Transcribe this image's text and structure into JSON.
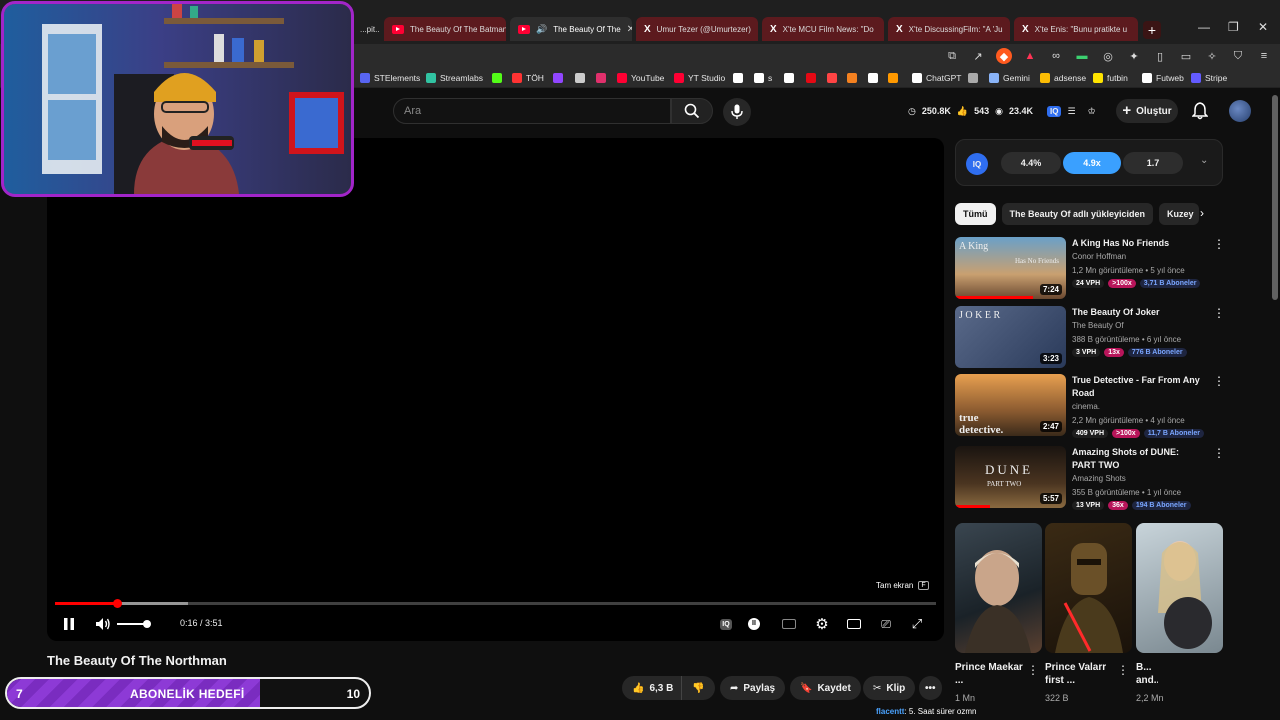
{
  "tabs": [
    {
      "title": "...pit...",
      "type": "yt"
    },
    {
      "title": "The Beauty Of The Batman",
      "type": "yt"
    },
    {
      "title": "The Beauty Of The",
      "type": "yt",
      "active": true
    },
    {
      "title": "Umur Tezer (@Umurtezer)",
      "type": "x"
    },
    {
      "title": "X'te MCU Film News: \"Do",
      "type": "x"
    },
    {
      "title": "X'te DiscussingFilm: \"A 'Ju",
      "type": "x"
    },
    {
      "title": "X'te Enis: \"Bunu pratikte u",
      "type": "x"
    }
  ],
  "window_controls": {
    "minimize": "—",
    "maximize": "❐",
    "close": "✕"
  },
  "bookmarks": [
    {
      "label": "STElements",
      "color": "#5865f2"
    },
    {
      "label": "Streamlabs",
      "color": "#31c3a2"
    },
    {
      "label": "",
      "color": "#53fc18"
    },
    {
      "label": "TÖH",
      "color": "#ff3333"
    },
    {
      "label": "",
      "color": "#9146ff"
    },
    {
      "label": "",
      "color": "#cccccc"
    },
    {
      "label": "",
      "color": "#e1306c"
    },
    {
      "label": "YouTube",
      "color": "#ff0033"
    },
    {
      "label": "YT Studio",
      "color": "#ff0033"
    },
    {
      "label": "",
      "color": "#ffffff"
    },
    {
      "label": "s",
      "color": "#ffffff"
    },
    {
      "label": "",
      "color": "#ffffff"
    },
    {
      "label": "",
      "color": "#e50914"
    },
    {
      "label": "",
      "color": "#ff4444"
    },
    {
      "label": "",
      "color": "#f48120"
    },
    {
      "label": "",
      "color": "#ffffff"
    },
    {
      "label": "",
      "color": "#ff9900"
    },
    {
      "label": "ChatGPT",
      "color": "#ffffff"
    },
    {
      "label": "",
      "color": "#aaaaaa"
    },
    {
      "label": "Gemini",
      "color": "#8ab4f8"
    },
    {
      "label": "adsense",
      "color": "#fbbc04"
    },
    {
      "label": "futbin",
      "color": "#ffe400"
    },
    {
      "label": "Futweb",
      "color": "#ffffff"
    },
    {
      "label": "Stripe",
      "color": "#635bff"
    }
  ],
  "header": {
    "search_placeholder": "Ara",
    "stats": {
      "views": "250.8K",
      "likes": "543",
      "eye": "23.4K"
    },
    "create_label": "Oluştur"
  },
  "player": {
    "current_time": "0:16",
    "separator": " / ",
    "duration": "3:51",
    "played_fraction": 0.07,
    "buffered_fraction": 0.151,
    "fullscreen_tip": "Tam ekran",
    "fullscreen_key": "F"
  },
  "video_title": "The Beauty Of The Northman",
  "actions": {
    "like_count": "6,3 B",
    "share": "Paylaş",
    "save": "Kaydet",
    "clip": "Klip"
  },
  "chat": {
    "user": "flacentt",
    "message": ": 5. Saat sürer ozmn"
  },
  "goal": {
    "left": "7",
    "label": "ABONELİK HEDEFİ",
    "right": "10",
    "fill_fraction": 0.7
  },
  "vidiq": {
    "logo": "IQ",
    "seg1": "4.4%",
    "seg2": "4.9x",
    "seg3": "1.7"
  },
  "chips": [
    "Tümü",
    "The Beauty Of adlı yükleyiciden",
    "Kuzey"
  ],
  "recommendations": [
    {
      "title": "A King Has No Friends",
      "channel": "Conor Hoffman",
      "meta": "1,2 Mn görüntüleme • 5 yıl önce",
      "duration": "7:24",
      "vph": "24 VPH",
      "ratio": ">100x",
      "subs": "3,71 B Aboneler",
      "thumb_text": "A King",
      "thumb_text2": "Has No Friends"
    },
    {
      "title": "The Beauty Of Joker",
      "channel": "The Beauty Of",
      "meta": "388 B görüntüleme • 6 yıl önce",
      "duration": "3:23",
      "vph": "3 VPH",
      "ratio": "13x",
      "subs": "776 B Aboneler",
      "thumb_text": "J  O  K  E  R",
      "thumb_text2": ""
    },
    {
      "title": "True Detective - Far From Any Road",
      "channel": "cinema.",
      "meta": "2,2 Mn görüntüleme • 4 yıl önce",
      "duration": "2:47",
      "vph": "409 VPH",
      "ratio": ">100x",
      "subs": "11,7 B Aboneler",
      "thumb_text": "true",
      "thumb_text2": "detective."
    },
    {
      "title": "Amazing Shots of DUNE: PART TWO",
      "channel": "Amazing Shots",
      "meta": "355 B görüntüleme • 1 yıl önce",
      "duration": "5:57",
      "vph": "13 VPH",
      "ratio": "36x",
      "subs": "194 B Aboneler",
      "thumb_text": "DUNE",
      "thumb_text2": "PART TWO"
    }
  ],
  "shorts": [
    {
      "title": "Prince Maekar ...",
      "views": "1 Mn"
    },
    {
      "title": "Prince Valarr first ...",
      "views": "322 B"
    },
    {
      "title": "B... and...",
      "views": "2,2 Mn"
    }
  ]
}
